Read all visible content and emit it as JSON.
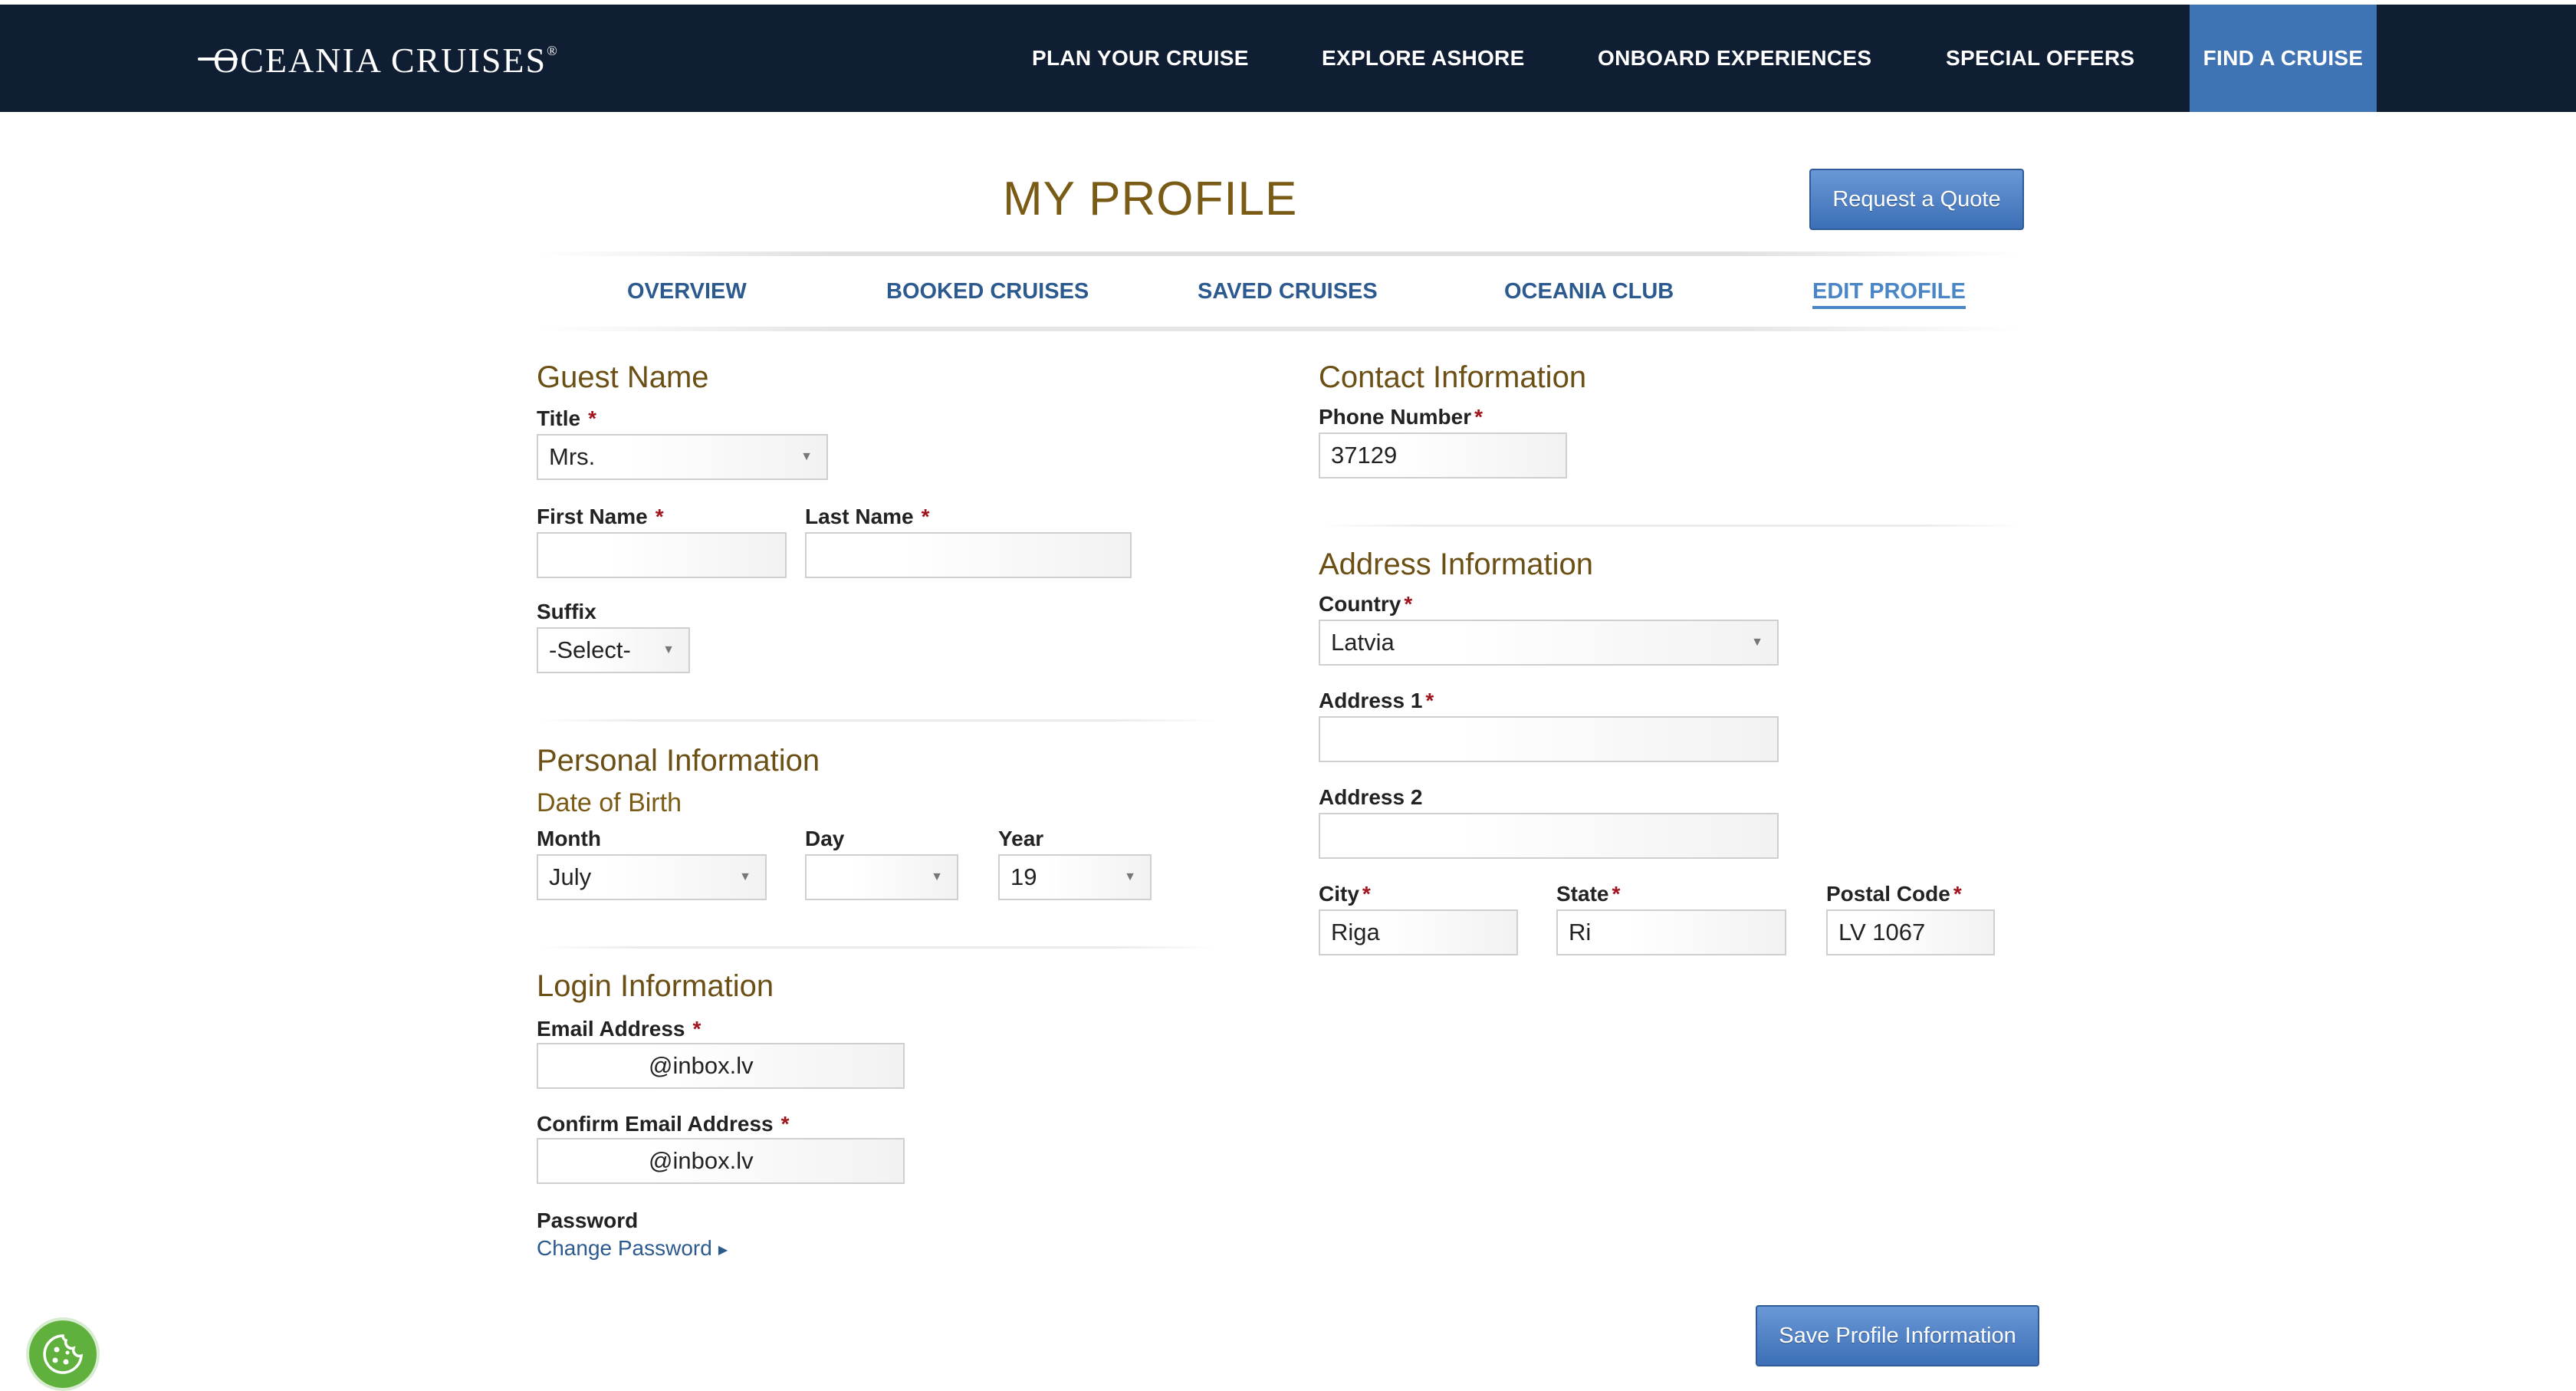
{
  "brand": {
    "name": "OCEANIA CRUISES",
    "reg": "®"
  },
  "nav": [
    {
      "label": "PLAN YOUR CRUISE"
    },
    {
      "label": "EXPLORE ASHORE"
    },
    {
      "label": "ONBOARD EXPERIENCES"
    },
    {
      "label": "SPECIAL OFFERS"
    },
    {
      "label": "FIND A CRUISE",
      "active": true
    }
  ],
  "page": {
    "title": "MY PROFILE",
    "quote_button": "Request a Quote"
  },
  "tabs": [
    {
      "label": "OVERVIEW"
    },
    {
      "label": "BOOKED CRUISES"
    },
    {
      "label": "SAVED CRUISES"
    },
    {
      "label": "OCEANIA CLUB"
    },
    {
      "label": "EDIT PROFILE",
      "active": true
    }
  ],
  "guest": {
    "heading": "Guest Name",
    "title_label": "Title",
    "title_value": "Mrs.",
    "first_label": "First Name",
    "first_value": "",
    "last_label": "Last Name",
    "last_value": "",
    "suffix_label": "Suffix",
    "suffix_value": "-Select-"
  },
  "personal": {
    "heading": "Personal Information",
    "dob_heading": "Date of Birth",
    "month_label": "Month",
    "month_value": "July",
    "day_label": "Day",
    "day_value": "",
    "year_label": "Year",
    "year_value": "19"
  },
  "login": {
    "heading": "Login Information",
    "email_label": "Email Address",
    "email_value": "@inbox.lv",
    "confirm_label": "Confirm Email Address",
    "confirm_value": "@inbox.lv",
    "password_label": "Password",
    "change_password": "Change Password"
  },
  "contact": {
    "heading": "Contact Information",
    "phone_label": "Phone Number",
    "phone_value": "37129"
  },
  "address": {
    "heading": "Address Information",
    "country_label": "Country",
    "country_value": "Latvia",
    "address1_label": "Address 1",
    "address1_value": "",
    "address2_label": "Address 2",
    "address2_value": "",
    "city_label": "City",
    "city_value": "Riga",
    "state_label": "State",
    "state_value": "Ri",
    "postal_label": "Postal Code",
    "postal_value": "LV 1067"
  },
  "actions": {
    "save": "Save Profile Information"
  },
  "required_mark": "*",
  "colors": {
    "nav_bg": "#0f1e33",
    "nav_active": "#3f73b4",
    "heading": "#6b4f14",
    "link": "#2c5a8f",
    "required": "#a0141e"
  }
}
